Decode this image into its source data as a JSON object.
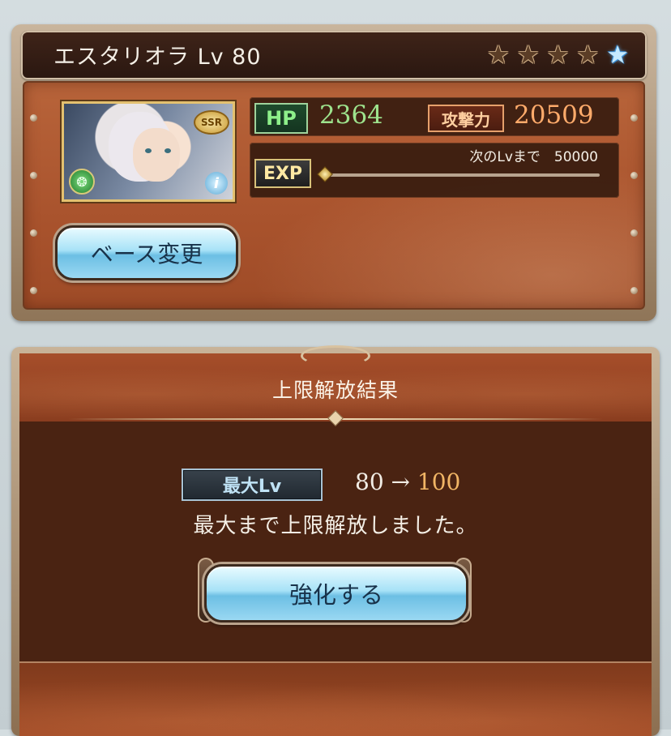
{
  "character": {
    "name_level": "エスタリオラ Lv 80",
    "stars": [
      "gold-star",
      "gold-star",
      "gold-star",
      "gold-star",
      "blue-star"
    ],
    "rarity_badge": "SSR",
    "element_icon": "wind-element-icon",
    "info_icon": "i"
  },
  "stats": {
    "hp_label": "HP",
    "hp_value": "2364",
    "atk_label": "攻撃力",
    "atk_value": "20509",
    "exp_label": "EXP",
    "exp_next_text": "次のLvまで　50000",
    "exp_progress": 0.0
  },
  "buttons": {
    "change_base": "ベース変更",
    "enhance": "強化する"
  },
  "result": {
    "title": "上限解放結果",
    "max_lv_label": "最大Lv",
    "lv_from": "80",
    "arrow": "→",
    "lv_to": "100",
    "message": "最大まで上限解放しました。"
  },
  "colors": {
    "hp": "#9ee38d",
    "atk": "#ffab6b",
    "lv_to": "#f1b565",
    "panel_bg": "#4a2312"
  }
}
